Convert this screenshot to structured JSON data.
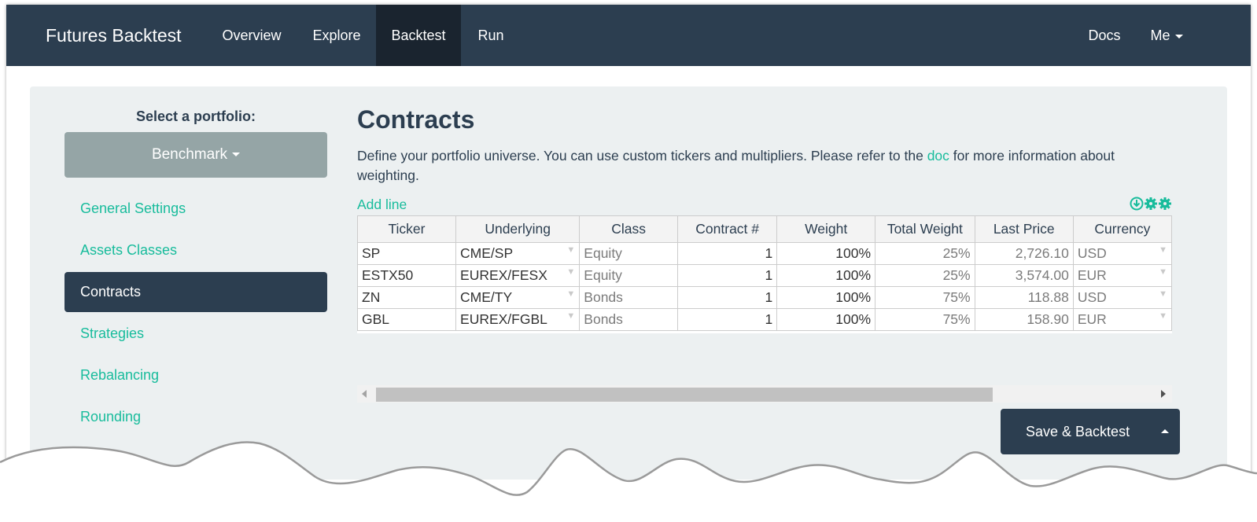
{
  "navbar": {
    "brand": "Futures Backtest",
    "items": [
      {
        "label": "Overview",
        "active": false
      },
      {
        "label": "Explore",
        "active": false
      },
      {
        "label": "Backtest",
        "active": true
      },
      {
        "label": "Run",
        "active": false
      }
    ],
    "right_items": [
      {
        "label": "Docs"
      },
      {
        "label": "Me",
        "dropdown": true
      }
    ]
  },
  "sidebar": {
    "select_label": "Select a portfolio:",
    "portfolio": "Benchmark",
    "items": [
      {
        "label": "General Settings",
        "active": false
      },
      {
        "label": "Assets Classes",
        "active": false
      },
      {
        "label": "Contracts",
        "active": true
      },
      {
        "label": "Strategies",
        "active": false
      },
      {
        "label": "Rebalancing",
        "active": false
      },
      {
        "label": "Rounding",
        "active": false
      }
    ]
  },
  "main": {
    "title": "Contracts",
    "desc_before": "Define your portfolio universe. You can use custom tickers and multipliers. Please refer to the ",
    "desc_link": "doc",
    "desc_after": " for more information about weighting.",
    "add_line": "Add line",
    "tool_icons": [
      "download-icon",
      "gear-icon",
      "gear-icon"
    ]
  },
  "table": {
    "columns": [
      "Ticker",
      "Underlying",
      "Class",
      "Contract #",
      "Weight",
      "Total Weight",
      "Last Price",
      "Currency"
    ],
    "rows": [
      [
        "SP",
        "CME/SP",
        "Equity",
        "1",
        "100%",
        "25%",
        "2,726.10",
        "USD"
      ],
      [
        "ESTX50",
        "EUREX/FESX",
        "Equity",
        "1",
        "100%",
        "25%",
        "3,574.00",
        "EUR"
      ],
      [
        "ZN",
        "CME/TY",
        "Bonds",
        "1",
        "100%",
        "75%",
        "118.88",
        "USD"
      ],
      [
        "GBL",
        "EUREX/FGBL",
        "Bonds",
        "1",
        "100%",
        "75%",
        "158.90",
        "EUR"
      ]
    ]
  },
  "actions": {
    "save_label": "Save & Backtest"
  },
  "colors": {
    "navbar": "#2c3e50",
    "accent": "#18bc9c",
    "panel": "#ecf0f1",
    "portfolio_button": "#95a5a6"
  }
}
